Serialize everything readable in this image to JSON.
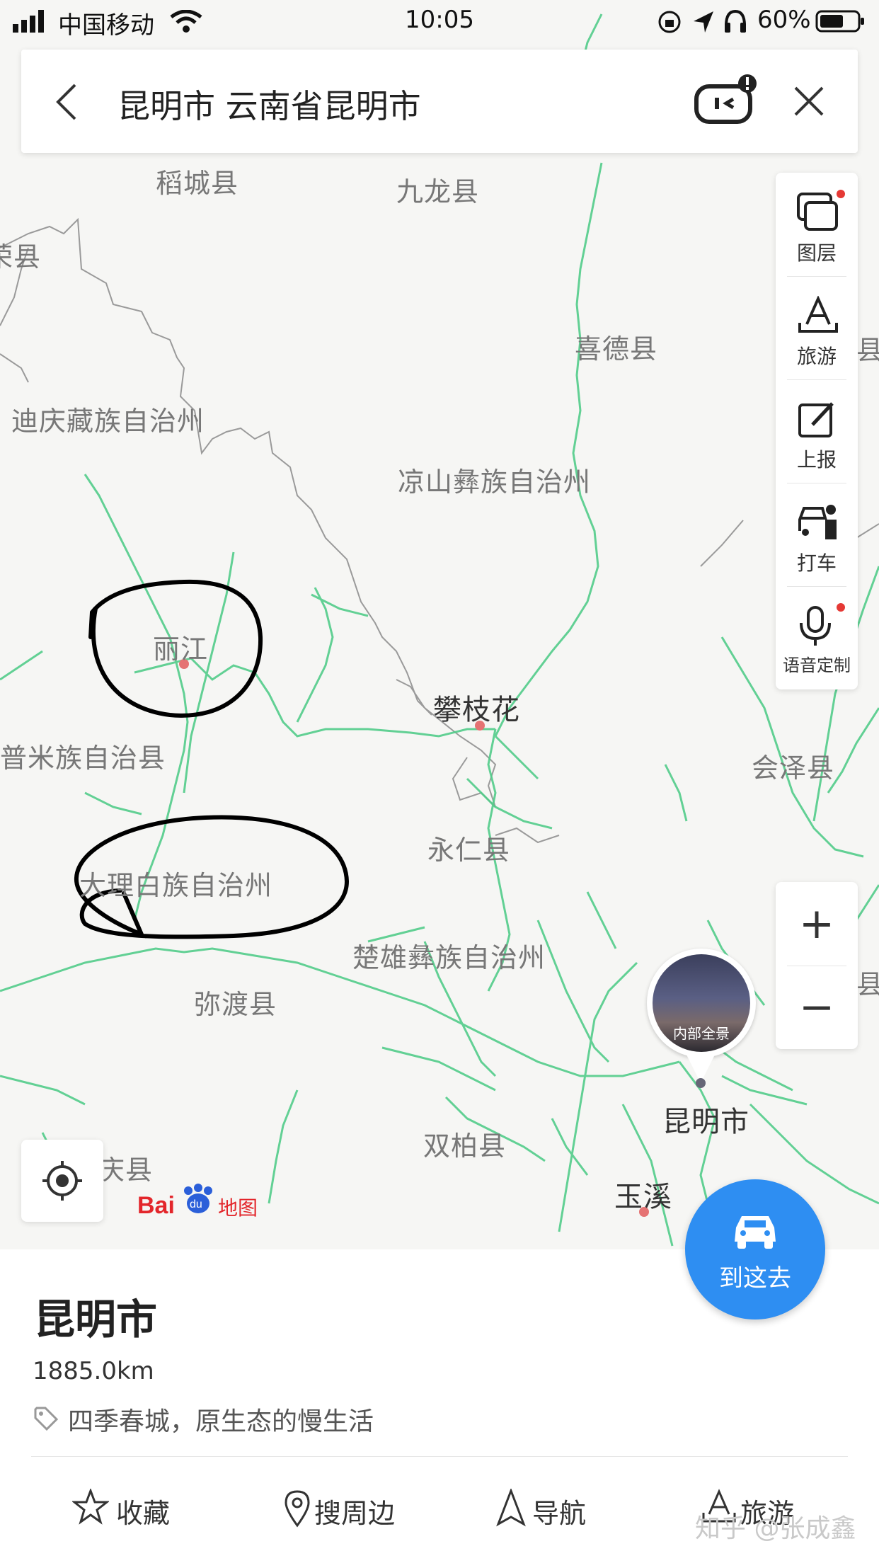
{
  "status_bar": {
    "carrier": "中国移动",
    "time": "10:05",
    "battery": "60%"
  },
  "search_bar": {
    "title": "昆明市 云南省昆明市"
  },
  "map": {
    "labels": [
      "稻城县",
      "九龙县",
      "荣县",
      "喜德县",
      "迪庆藏族自治州",
      "凉山彝族自治州",
      "丽江",
      "攀枝花",
      "普米族自治县",
      "会泽县",
      "永仁县",
      "大理白族自治州",
      "楚雄彝族自治州",
      "弥渡县",
      "双柏县",
      "昆明市",
      "庆县",
      "玉溪",
      "县",
      "县"
    ],
    "pano_label": "内部全景",
    "logo_text": "Baidu地图",
    "road_color": "#52cc8a",
    "annotation_color": "#000000"
  },
  "tools": [
    {
      "label": "图层",
      "icon": "layers-icon",
      "badge": true
    },
    {
      "label": "旅游",
      "icon": "travel-icon",
      "badge": false
    },
    {
      "label": "上报",
      "icon": "report-icon",
      "badge": false
    },
    {
      "label": "打车",
      "icon": "taxi-icon",
      "badge": false
    },
    {
      "label": "语音定制",
      "icon": "microphone-icon",
      "badge": true
    }
  ],
  "zoom": {
    "in": "+",
    "out": "−"
  },
  "go_button": {
    "label": "到这去"
  },
  "place": {
    "name": "昆明市",
    "distance": "1885.0km",
    "tagline": "四季春城，原生态的慢生活"
  },
  "actions": [
    {
      "label": "收藏",
      "icon": "star-icon"
    },
    {
      "label": "搜周边",
      "icon": "location-pin-icon"
    },
    {
      "label": "导航",
      "icon": "navigate-arrow-icon"
    },
    {
      "label": "旅游",
      "icon": "travel-icon"
    }
  ],
  "watermark": "知乎 @张成鑫"
}
